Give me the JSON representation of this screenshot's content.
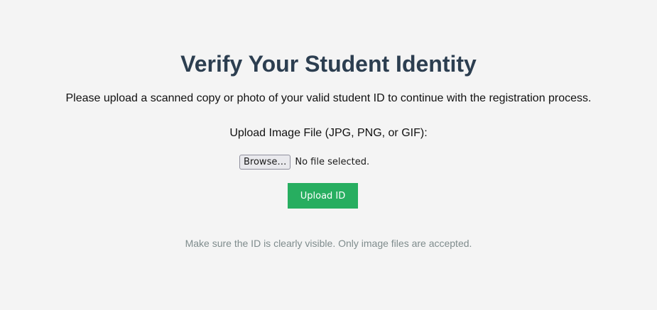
{
  "page": {
    "title": "Verify Your Student Identity",
    "intro": "Please upload a scanned copy or photo of your valid student ID to continue with the registration process.",
    "hint": "Make sure the ID is clearly visible. Only image files are accepted."
  },
  "upload_form": {
    "field_label": "Upload Image File (JPG, PNG, or GIF):",
    "browse_label": "Browse…",
    "file_status": "No file selected.",
    "submit_label": "Upload ID"
  },
  "colors": {
    "background": "#f4f4f4",
    "title": "#2c3e50",
    "submit_button": "#27ae60",
    "hint_text": "#7f8c8d"
  }
}
